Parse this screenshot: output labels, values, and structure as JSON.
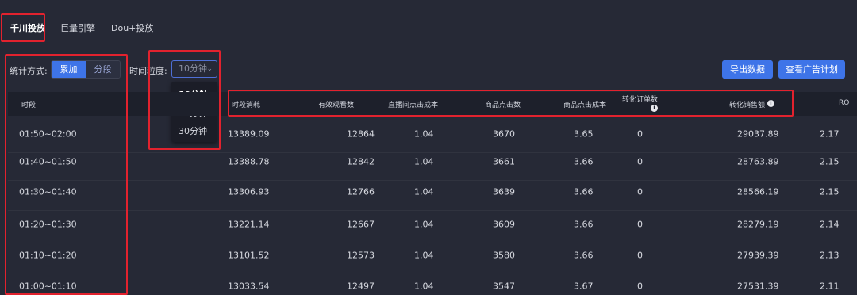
{
  "tabs": [
    {
      "label": "千川投放",
      "active": true
    },
    {
      "label": "巨量引擎",
      "active": false
    },
    {
      "label": "Dou+投放",
      "active": false
    }
  ],
  "stats": {
    "label": "统计方式:",
    "options": [
      "累加",
      "分段"
    ],
    "selected": "累加"
  },
  "granularity": {
    "label": "时间粒度:",
    "value": "10分钟",
    "options": [
      "10分钟",
      "20分钟",
      "30分钟"
    ]
  },
  "buttons": {
    "export": "导出数据",
    "view_plan": "查看广告计划"
  },
  "table": {
    "headers": {
      "period": "时段",
      "spend": "时段消耗",
      "views": "有效观看数",
      "cpc_live": "直播间点击成本",
      "product_clicks": "商品点击数",
      "product_cpc": "商品点击成本",
      "orders": "转化订单数",
      "gmv": "转化销售额",
      "roi": "RO"
    },
    "rows": [
      {
        "period": "01:50~02:00",
        "spend": "13389.09",
        "views": "12864",
        "cpc_live": "1.04",
        "product_clicks": "3670",
        "product_cpc": "3.65",
        "orders": "0",
        "gmv": "29037.89",
        "roi": "2.17"
      },
      {
        "period": "01:40~01:50",
        "spend": "13388.78",
        "views": "12842",
        "cpc_live": "1.04",
        "product_clicks": "3661",
        "product_cpc": "3.66",
        "orders": "0",
        "gmv": "28763.89",
        "roi": "2.15"
      },
      {
        "period": "01:30~01:40",
        "spend": "13306.93",
        "views": "12766",
        "cpc_live": "1.04",
        "product_clicks": "3639",
        "product_cpc": "3.66",
        "orders": "0",
        "gmv": "28566.19",
        "roi": "2.15"
      },
      {
        "period": "01:20~01:30",
        "spend": "13221.14",
        "views": "12667",
        "cpc_live": "1.04",
        "product_clicks": "3609",
        "product_cpc": "3.66",
        "orders": "0",
        "gmv": "28279.19",
        "roi": "2.14"
      },
      {
        "period": "01:10~01:20",
        "spend": "13101.52",
        "views": "12573",
        "cpc_live": "1.04",
        "product_clicks": "3580",
        "product_cpc": "3.66",
        "orders": "0",
        "gmv": "27939.39",
        "roi": "2.13"
      },
      {
        "period": "01:00~01:10",
        "spend": "13033.54",
        "views": "12497",
        "cpc_live": "1.04",
        "product_clicks": "3547",
        "product_cpc": "3.67",
        "orders": "0",
        "gmv": "27531.39",
        "roi": "2.11"
      }
    ]
  },
  "icons": {
    "info": "info-icon",
    "chevron": "chevron-down-icon"
  },
  "colors": {
    "background": "#262936",
    "header_bg": "#1d202b",
    "accent": "#3e74e8",
    "highlight_box": "#e2222e"
  }
}
